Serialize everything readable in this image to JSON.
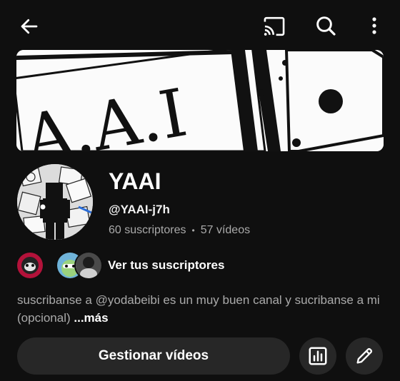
{
  "topbar": {
    "back_icon": "arrow-left-icon",
    "cast_icon": "cast-icon",
    "search_icon": "search-icon",
    "menu_icon": "more-vertical-icon"
  },
  "banner": {
    "text": "A.A.I"
  },
  "channel": {
    "name": "YAAI",
    "handle": "@YAAI-j7h",
    "subscribers": "60 suscriptores",
    "separator": "•",
    "videos": "57 vídeos"
  },
  "subscribers_row": {
    "label": "Ver tus suscriptores"
  },
  "description": {
    "text": "suscribanse a @yodabeibi es un muy buen canal y sucribanse a mi (opcional) ",
    "more": "...más"
  },
  "actions": {
    "manage_label": "Gestionar vídeos",
    "analytics_icon": "analytics-icon",
    "edit_icon": "pencil-icon"
  },
  "colors": {
    "background": "#0f0f0f",
    "button_bg": "#272727",
    "secondary_text": "#aaaaaa"
  }
}
